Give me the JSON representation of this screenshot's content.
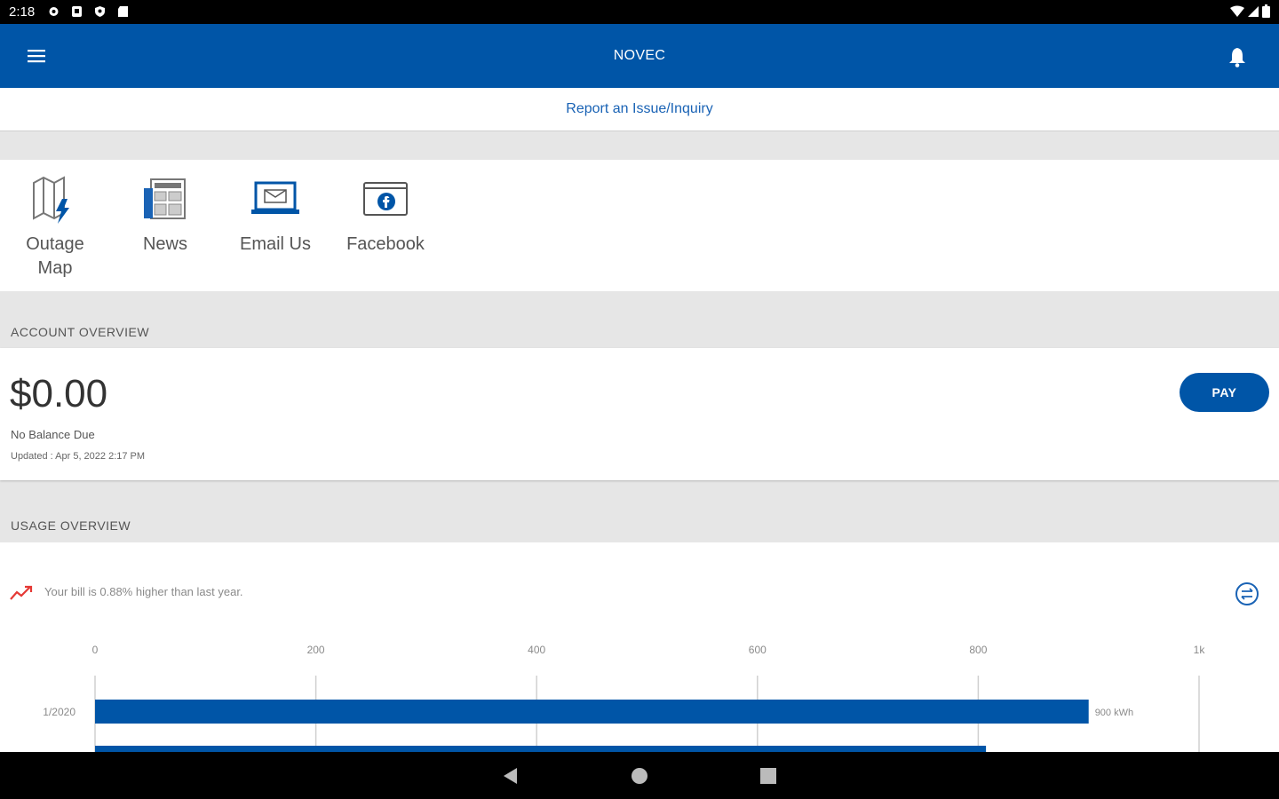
{
  "status_bar": {
    "time": "2:18"
  },
  "app_bar": {
    "title": "NOVEC"
  },
  "report": {
    "label": "Report an Issue/Inquiry"
  },
  "quick_links": [
    {
      "label_line1": "Outage",
      "label_line2": "Map",
      "icon": "outage-map-icon"
    },
    {
      "label_line1": "News",
      "label_line2": "",
      "icon": "news-icon"
    },
    {
      "label_line1": "Email Us",
      "label_line2": "",
      "icon": "email-icon"
    },
    {
      "label_line1": "Facebook",
      "label_line2": "",
      "icon": "facebook-icon"
    }
  ],
  "account": {
    "heading": "ACCOUNT OVERVIEW",
    "amount": "$0.00",
    "status": "No Balance Due",
    "updated": "Updated : Apr 5, 2022 2:17 PM",
    "pay_label": "PAY"
  },
  "usage": {
    "heading": "USAGE OVERVIEW",
    "trend_text": "Your bill is 0.88% higher than last year.",
    "trend_color": "#e53935"
  },
  "chart_data": {
    "type": "bar",
    "orientation": "horizontal",
    "categories": [
      "1/2020",
      ""
    ],
    "values": [
      900,
      807
    ],
    "value_labels": [
      "900 kWh",
      ""
    ],
    "x_ticks": [
      "0",
      "200",
      "400",
      "600",
      "800",
      "1k"
    ],
    "xlim": [
      0,
      1000
    ],
    "bar_color": "#0055a7",
    "grid": true
  },
  "colors": {
    "primary": "#0055a7",
    "link": "#1a63b5"
  }
}
